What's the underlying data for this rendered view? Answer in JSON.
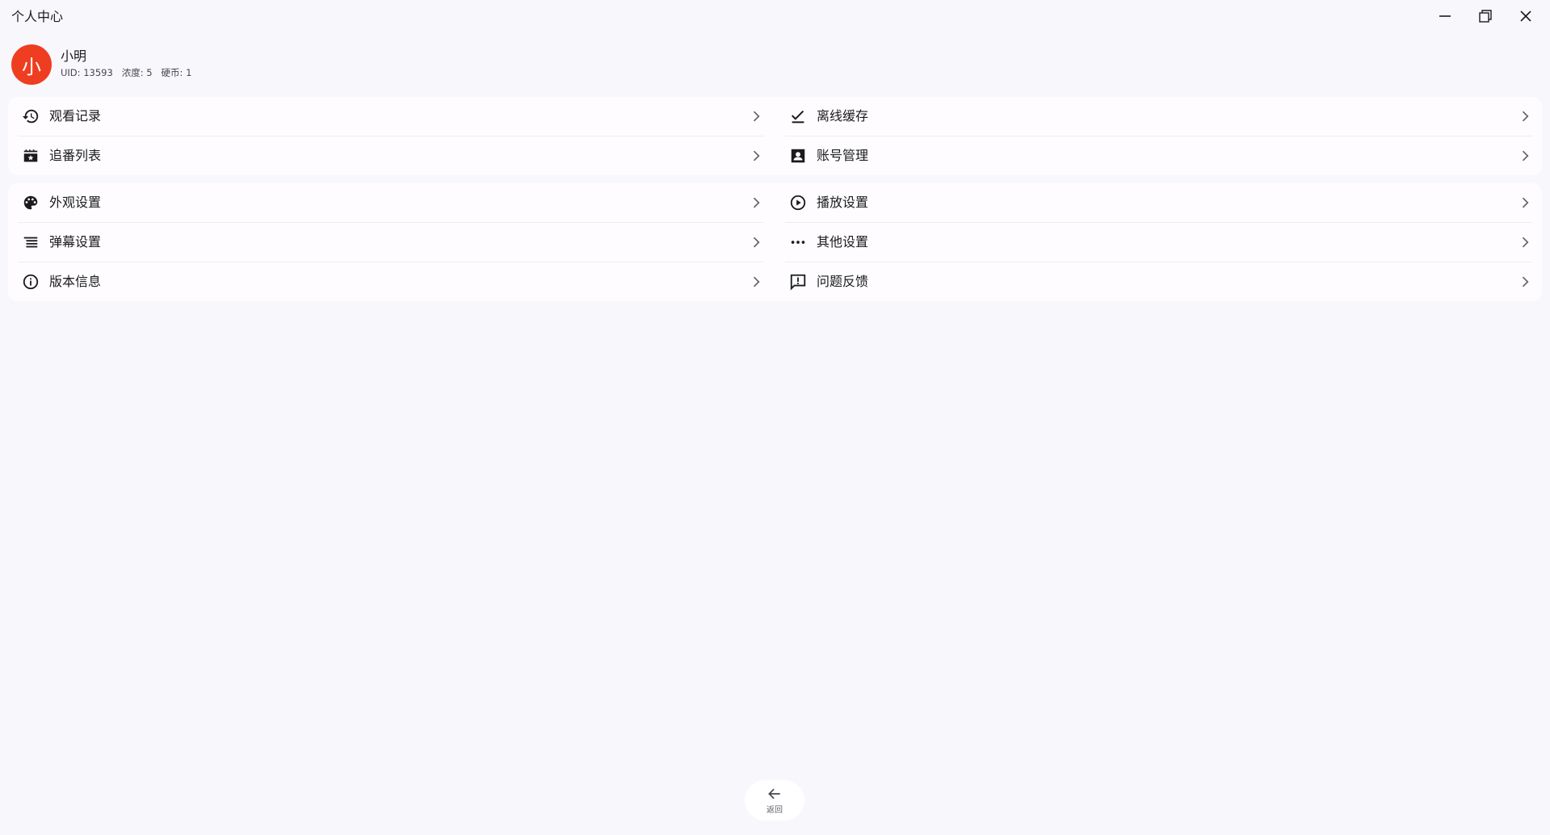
{
  "window": {
    "title": "个人中心",
    "controls": [
      {
        "icon": "minimize-icon"
      },
      {
        "icon": "maximize-icon"
      },
      {
        "icon": "close-icon"
      }
    ]
  },
  "profile": {
    "avatar_char": "小",
    "avatar_color": "#ef3d22",
    "username": "小明",
    "stats": "UID: 13593   浓度: 5   硬币: 1"
  },
  "groups": [
    {
      "items": [
        {
          "label": "观看记录",
          "icon": "history-icon"
        },
        {
          "label": "离线缓存",
          "icon": "check-icon"
        },
        {
          "label": "追番列表",
          "icon": "video-library-icon"
        },
        {
          "label": "账号管理",
          "icon": "account-box-icon"
        }
      ]
    },
    {
      "items": [
        {
          "label": "外观设置",
          "icon": "palette-icon"
        },
        {
          "label": "播放设置",
          "icon": "play-circle-icon"
        },
        {
          "label": "弹幕设置",
          "icon": "subject-icon"
        },
        {
          "label": "其他设置",
          "icon": "more-horiz-icon"
        },
        {
          "label": "版本信息",
          "icon": "info-icon"
        },
        {
          "label": "问题反馈",
          "icon": "feedback-icon"
        }
      ]
    }
  ],
  "back": {
    "label": "返回",
    "icon": "arrow-back-icon"
  }
}
